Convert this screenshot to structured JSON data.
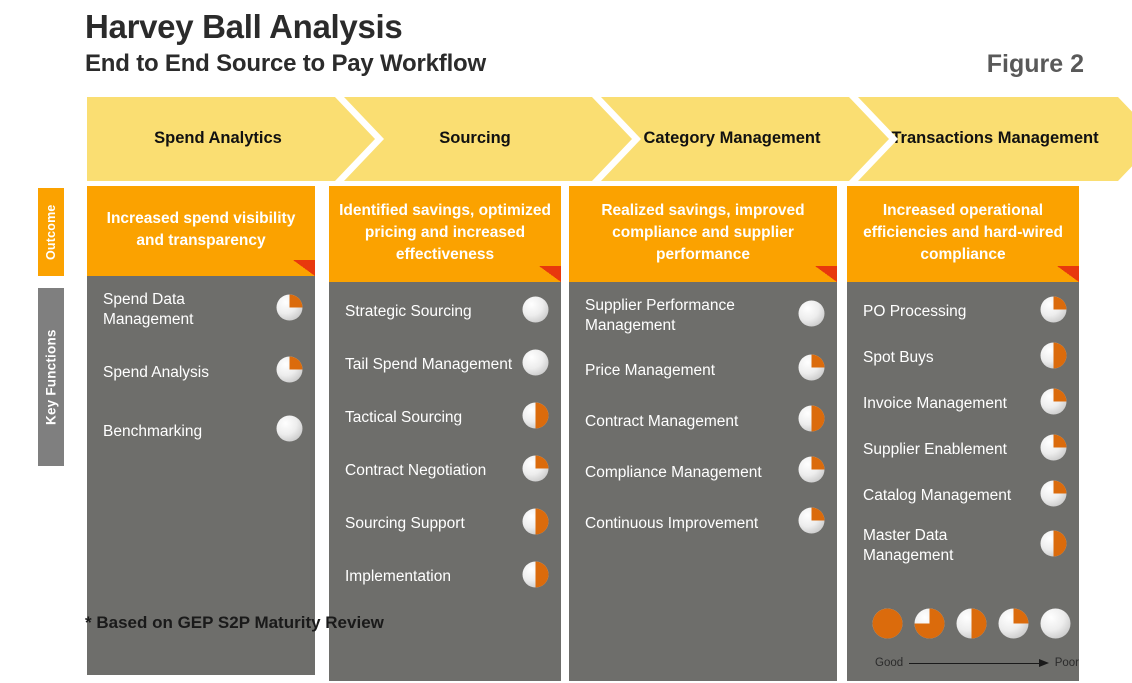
{
  "header": {
    "title": "Harvey Ball Analysis",
    "subtitle": "End to End Source to Pay Workflow",
    "figure_label": "Figure 2"
  },
  "row_labels": {
    "outcome": "Outcome",
    "key_functions": "Key Functions"
  },
  "colors": {
    "chevron": "#FADE72",
    "outcome": "#FBA200",
    "body": "#6E6E6B",
    "ball_fill": "#DB6B0C",
    "ball_empty": "#E3E3E3",
    "fold": "#E8380D",
    "label_gray": "#7F7F7F"
  },
  "columns": [
    {
      "stage": "Spend Analytics",
      "outcome": "Increased spend visibility and transparency",
      "functions": [
        {
          "label": "Spend Data Management",
          "score": 25
        },
        {
          "label": "Spend Analysis",
          "score": 25
        },
        {
          "label": "Benchmarking",
          "score": 0
        }
      ]
    },
    {
      "stage": "Sourcing",
      "outcome": "Identified savings, optimized pricing and increased effectiveness",
      "functions": [
        {
          "label": "Strategic Sourcing",
          "score": 0
        },
        {
          "label": "Tail Spend Management",
          "score": 0
        },
        {
          "label": "Tactical Sourcing",
          "score": 50
        },
        {
          "label": "Contract Negotiation",
          "score": 25
        },
        {
          "label": "Sourcing Support",
          "score": 50
        },
        {
          "label": "Implementation",
          "score": 50
        }
      ]
    },
    {
      "stage": "Category Management",
      "outcome": "Realized savings, improved compliance and supplier performance",
      "functions": [
        {
          "label": "Supplier Performance Management",
          "score": 0
        },
        {
          "label": "Price Management",
          "score": 25
        },
        {
          "label": "Contract Management",
          "score": 50
        },
        {
          "label": "Compliance Management",
          "score": 25
        },
        {
          "label": "Continuous Improvement",
          "score": 25
        }
      ]
    },
    {
      "stage": "Transactions Management",
      "outcome": "Increased operational efficiencies and hard-wired compliance",
      "functions": [
        {
          "label": "PO Processing",
          "score": 25
        },
        {
          "label": "Spot Buys",
          "score": 50
        },
        {
          "label": "Invoice Management",
          "score": 25
        },
        {
          "label": "Supplier Enablement",
          "score": 25
        },
        {
          "label": "Catalog Management",
          "score": 25
        },
        {
          "label": "Master Data Management",
          "score": 50
        }
      ]
    }
  ],
  "footer": {
    "footnote": "* Based on GEP S2P Maturity Review",
    "legend_values": [
      100,
      75,
      50,
      25,
      0
    ],
    "legend_good": "Good",
    "legend_poor": "Poor"
  },
  "chart_data": {
    "type": "table",
    "title": "Harvey Ball Analysis - End to End Source to Pay Workflow",
    "scale": "0 = Poor (empty ball), 100 = Good (full ball)",
    "categories": [
      "Spend Analytics",
      "Sourcing",
      "Category Management",
      "Transactions Management"
    ],
    "series": [
      {
        "name": "Spend Analytics",
        "items": [
          "Spend Data Management",
          "Spend Analysis",
          "Benchmarking"
        ],
        "values": [
          25,
          25,
          0
        ]
      },
      {
        "name": "Sourcing",
        "items": [
          "Strategic Sourcing",
          "Tail Spend Management",
          "Tactical Sourcing",
          "Contract Negotiation",
          "Sourcing Support",
          "Implementation"
        ],
        "values": [
          0,
          0,
          50,
          25,
          50,
          50
        ]
      },
      {
        "name": "Category Management",
        "items": [
          "Supplier Performance Management",
          "Price Management",
          "Contract Management",
          "Compliance Management",
          "Continuous Improvement"
        ],
        "values": [
          0,
          25,
          50,
          25,
          25
        ]
      },
      {
        "name": "Transactions Management",
        "items": [
          "PO Processing",
          "Spot Buys",
          "Invoice Management",
          "Supplier Enablement",
          "Catalog Management",
          "Master Data Management"
        ],
        "values": [
          25,
          50,
          25,
          25,
          25,
          50
        ]
      }
    ]
  }
}
